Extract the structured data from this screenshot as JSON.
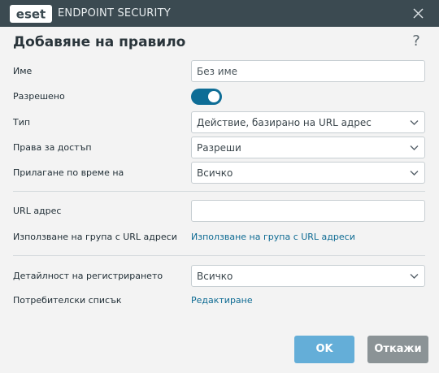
{
  "titlebar": {
    "logo_text": "eset",
    "app_name": "ENDPOINT SECURITY",
    "close_icon": "close-icon"
  },
  "dialog": {
    "title": "Добавяне на правило",
    "help_label": "?"
  },
  "form": {
    "name_label": "Име",
    "name_placeholder": "Без име",
    "enabled_label": "Разрешено",
    "enabled_value": true,
    "type_label": "Тип",
    "type_value": "Действие, базирано на URL адрес",
    "access_label": "Права за достъп",
    "access_value": "Разреши",
    "apply_time_label": "Прилагане по време на",
    "apply_time_value": "Всичко",
    "url_label": "URL адрес",
    "url_value": "",
    "url_group_label": "Използване на група с URL адреси",
    "url_group_link": "Използване на група с URL адреси",
    "log_level_label": "Детайлност на регистрирането",
    "log_level_value": "Всичко",
    "user_list_label": "Потребителски списък",
    "user_list_link": "Редактиране"
  },
  "buttons": {
    "ok_label": "OK",
    "cancel_label": "Откажи"
  },
  "colors": {
    "titlebar": "#3b4a51",
    "accent": "#0e6d96",
    "link": "#0e6b93",
    "ok_button": "#64aed8",
    "cancel_button": "#8b9396",
    "background": "#f3f3f3"
  }
}
